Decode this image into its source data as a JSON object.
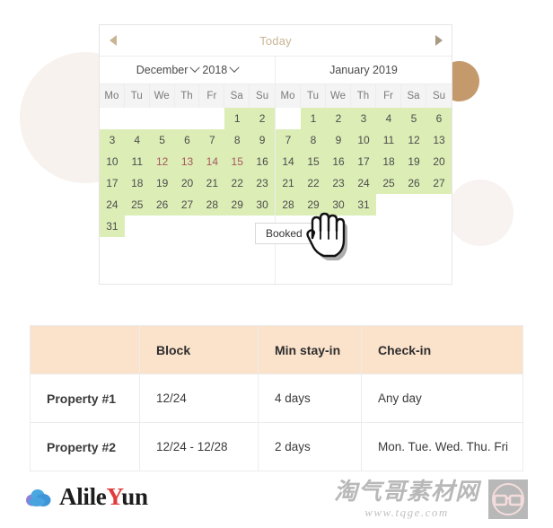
{
  "calendar": {
    "nav": {
      "prev_icon": "chevron-left-icon",
      "next_icon": "chevron-right-icon",
      "today_label": "Today"
    },
    "left_month": {
      "month_label": "December",
      "year_label": "2018",
      "dow": [
        "Mo",
        "Tu",
        "We",
        "Th",
        "Fr",
        "Sa",
        "Su"
      ],
      "cells": [
        "",
        "",
        "",
        "",
        "",
        "1",
        "2",
        "3",
        "4",
        "5",
        "6",
        "7",
        "8",
        "9",
        "10",
        "11",
        "12",
        "13",
        "14",
        "15",
        "16",
        "17",
        "18",
        "19",
        "20",
        "21",
        "22",
        "23",
        "24",
        "25",
        "26",
        "27",
        "28",
        "29",
        "30",
        "31",
        "",
        "",
        "",
        "",
        "",
        ""
      ],
      "available_indices": [
        5,
        6,
        7,
        8,
        9,
        10,
        11,
        12,
        13,
        14,
        15,
        16,
        17,
        18,
        19,
        20,
        21,
        22,
        23,
        24,
        25,
        26,
        27,
        28,
        29,
        30,
        31,
        32,
        33,
        34,
        35
      ],
      "booked_indices": [
        16,
        17,
        18,
        19
      ],
      "booked_tooltip": "Booked"
    },
    "right_month": {
      "month_label": "January 2019",
      "dow": [
        "Mo",
        "Tu",
        "We",
        "Th",
        "Fr",
        "Sa",
        "Su"
      ],
      "cells": [
        "",
        "1",
        "2",
        "3",
        "4",
        "5",
        "6",
        "7",
        "8",
        "9",
        "10",
        "11",
        "12",
        "13",
        "14",
        "15",
        "16",
        "17",
        "18",
        "19",
        "20",
        "21",
        "22",
        "23",
        "24",
        "25",
        "26",
        "27",
        "28",
        "29",
        "30",
        "31",
        "",
        "",
        ""
      ],
      "available_indices": [
        1,
        2,
        3,
        4,
        5,
        6,
        7,
        8,
        9,
        10,
        11,
        12,
        13,
        14,
        15,
        16,
        17,
        18,
        19,
        20,
        21,
        22,
        23,
        24,
        25,
        26,
        27,
        28,
        29,
        30,
        31
      ]
    },
    "colors": {
      "available": "#dcedb6",
      "booked": "#efa5ab",
      "accent": "#c9b494"
    }
  },
  "table": {
    "headers": [
      "",
      "Block",
      "Min stay-in",
      "Check-in"
    ],
    "rows": [
      [
        "Property #1",
        "12/24",
        "4 days",
        "Any day"
      ],
      [
        "Property #2",
        "12/24 - 12/28",
        "2 days",
        "Mon. Tue. Wed. Thu. Fri"
      ]
    ],
    "header_bg": "#fbe2cb"
  },
  "footer": {
    "logo_icon": "cloud-icon",
    "logo_pre": "Alile",
    "logo_highlight": "Y",
    "logo_post": "un",
    "watermark_cn": "淘气哥素材网",
    "watermark_url": "www.tqge.com",
    "watermark_icon": "glasses-icon"
  }
}
